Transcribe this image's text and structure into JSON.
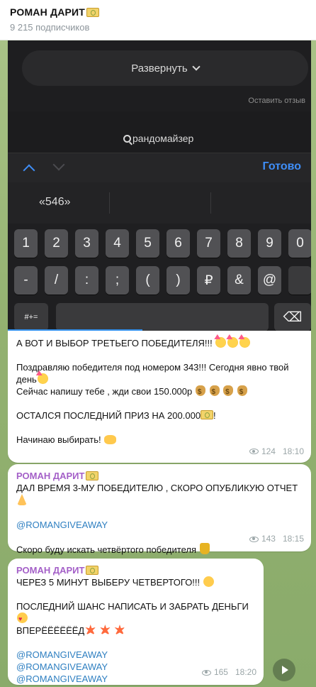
{
  "header": {
    "channel_name": "РОМАН ДАРИТ",
    "subscribers": "9 215 подписчиков"
  },
  "screenshot": {
    "expand_label": "Развернуть",
    "leave_review": "Оставить отзыв",
    "search_text": "рандомайзер",
    "done_label": "Готово",
    "suggestion": "«546»",
    "keys_row1": [
      "1",
      "2",
      "3",
      "4",
      "5",
      "6",
      "7",
      "8",
      "9",
      "0"
    ],
    "keys_row2": [
      "-",
      "/",
      ":",
      ";",
      "(",
      ")",
      "₽",
      "&",
      "@"
    ],
    "key_symbols": "#+="
  },
  "messages": [
    {
      "lines": [
        "А ВОТ И ВЫБОР ТРЕТЬЕГО ПОБЕДИТЕЛЯ!!!",
        "Поздравляю победителя под номером 343!!! Сегодня явно твой день",
        "Сейчас напишу тебе , жди свои 150.000р",
        "ОСТАЛСЯ ПОСЛЕДНИЙ ПРИЗ НА 200.000",
        "Начинаю выбирать!"
      ],
      "views": "124",
      "time": "18:10"
    },
    {
      "sender": "РОМАН ДАРИТ",
      "lines": [
        "ДАЛ ВРЕМЯ 3-МУ ПОБЕДИТЕЛЮ , СКОРО ОПУБЛИКУЮ ОТЧЕТ",
        "@ROMANGIVEAWAY",
        "Скоро буду искать четвёртого победителя"
      ],
      "views": "143",
      "time": "18:15"
    },
    {
      "sender": "РОМАН ДАРИТ",
      "lines": [
        "ЧЕРЕЗ 5 МИНУТ ВЫБЕРУ ЧЕТВЕРТОГО!!!",
        "ПОСЛЕДНИЙ ШАНС НАПИСАТЬ И ЗАБРАТЬ ДЕНЬГИ",
        "ВПЕРЁЁЁЁЁЁД",
        "@ROMANGIVEAWAY",
        "@ROMANGIVEAWAY",
        "@ROMANGIVEAWAY"
      ],
      "views": "165",
      "time": "18:20"
    }
  ],
  "icons": {
    "money": "money-with-wings-icon",
    "views": "eye-icon",
    "share": "share-arrow-icon"
  }
}
